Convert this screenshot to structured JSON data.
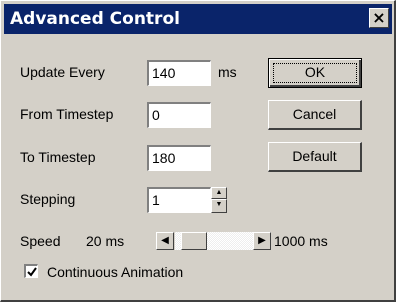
{
  "window": {
    "title": "Advanced Control",
    "close_glyph": "×",
    "close_icon": "close-icon"
  },
  "fields": {
    "update_every": {
      "label": "Update Every",
      "value": "140",
      "unit": "ms"
    },
    "from_timestep": {
      "label": "From Timestep",
      "value": "0"
    },
    "to_timestep": {
      "label": "To Timestep",
      "value": "180"
    },
    "stepping": {
      "label": "Stepping",
      "value": "1"
    }
  },
  "spinner": {
    "up_glyph": "▲",
    "down_glyph": "▼"
  },
  "speed": {
    "label": "Speed",
    "min_label": "20 ms",
    "max_label": "1000 ms",
    "min": 20,
    "max": 1000,
    "left_glyph": "◀",
    "right_glyph": "▶"
  },
  "buttons": {
    "ok": "OK",
    "cancel": "Cancel",
    "default": "Default"
  },
  "checkbox": {
    "label": "Continuous Animation",
    "checked": true
  }
}
